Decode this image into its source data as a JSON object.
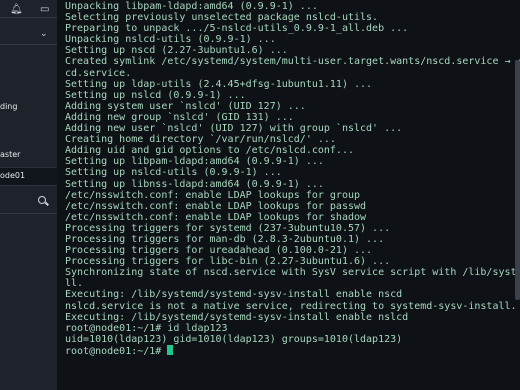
{
  "sidebar": {
    "item_ding": "ding",
    "item_master": "aster",
    "active_item": "ode01",
    "icons": [
      "bell-icon",
      "message-icon",
      "chevron-down-icon",
      "search-icon"
    ]
  },
  "terminal": {
    "lines": [
      "Unpacking libpam-ldapd:amd64 (0.9.9-1) ...",
      "Selecting previously unselected package nslcd-utils.",
      "Preparing to unpack .../5-nslcd-utils_0.9.9-1_all.deb ...",
      "Unpacking nslcd-utils (0.9.9-1) ...",
      "Setting up nscd (2.27-3ubuntu1.6) ...",
      "Created symlink /etc/systemd/system/multi-user.target.wants/nscd.service → /lib/system",
      "cd.service.",
      "Setting up ldap-utils (2.4.45+dfsg-1ubuntu1.11) ...",
      "Setting up nslcd (0.9.9-1) ...",
      "Adding system user `nslcd' (UID 127) ...",
      "Adding new group `nslcd' (GID 131) ...",
      "Adding new user `nslcd' (UID 127) with group `nslcd' ...",
      "Creating home directory `/var/run/nslcd/' ...",
      "Adding uid and gid options to /etc/nslcd.conf...",
      "Setting up libpam-ldapd:amd64 (0.9.9-1) ...",
      "Setting up nslcd-utils (0.9.9-1) ...",
      "Setting up libnss-ldapd:amd64 (0.9.9-1) ...",
      "/etc/nsswitch.conf: enable LDAP lookups for group",
      "/etc/nsswitch.conf: enable LDAP lookups for passwd",
      "/etc/nsswitch.conf: enable LDAP lookups for shadow",
      "Processing triggers for systemd (237-3ubuntu10.57) ...",
      "Processing triggers for man-db (2.8.3-2ubuntu0.1) ...",
      "Processing triggers for ureadahead (0.100.0-21) ...",
      "Processing triggers for libc-bin (2.27-3ubuntu1.6) ...",
      "Synchronizing state of nscd.service with SysV service script with /lib/systemd/systemc",
      "ll.",
      "Executing: /lib/systemd/systemd-sysv-install enable nscd",
      "nslcd.service is not a native service, redirecting to systemd-sysv-install.",
      "Executing: /lib/systemd/systemd-sysv-install enable nslcd",
      "root@node01:~/1# id ldap123",
      "uid=1010(ldap123) gid=1010(ldap123) groups=1010(ldap123)"
    ],
    "prompt": "root@node01:~/1# "
  }
}
